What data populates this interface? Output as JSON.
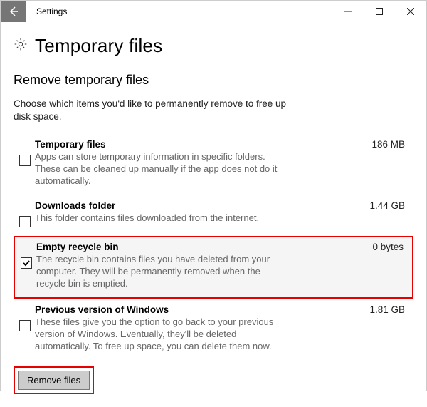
{
  "window": {
    "title": "Settings"
  },
  "page": {
    "title": "Temporary files",
    "section_title": "Remove temporary files",
    "intro": "Choose which items you'd like to permanently remove to free up disk space."
  },
  "items": [
    {
      "title": "Temporary files",
      "size": "186 MB",
      "desc": "Apps can store temporary information in specific folders. These can be cleaned up manually if the app does not do it automatically.",
      "checked": false,
      "highlighted": false
    },
    {
      "title": "Downloads folder",
      "size": "1.44 GB",
      "desc": "This folder contains files downloaded from the internet.",
      "checked": false,
      "highlighted": false
    },
    {
      "title": "Empty recycle bin",
      "size": "0 bytes",
      "desc": "The recycle bin contains files you have deleted from your computer. They will be permanently removed when the recycle bin is emptied.",
      "checked": true,
      "highlighted": true
    },
    {
      "title": "Previous version of Windows",
      "size": "1.81 GB",
      "desc": "These files give you the option to go back to your previous version of Windows. Eventually, they'll be deleted automatically. To free up space, you can delete them now.",
      "checked": false,
      "highlighted": false
    }
  ],
  "actions": {
    "remove_label": "Remove files"
  }
}
